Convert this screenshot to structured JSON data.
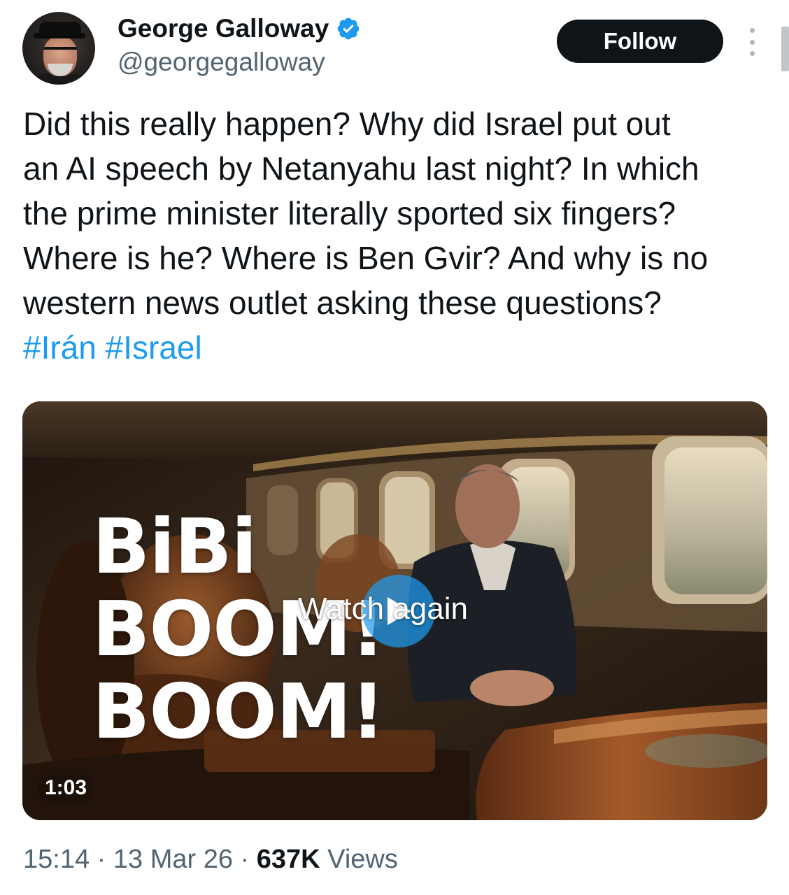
{
  "author": {
    "display_name": "George Galloway",
    "handle": "@georgegalloway",
    "verified_icon": "verified-badge-icon",
    "verified_color": "#1d9bf0"
  },
  "actions": {
    "follow_label": "Follow",
    "more_icon": "more-vertical-icon"
  },
  "tweet": {
    "text_lines": [
      "Did this really happen? Why did Israel put out",
      "an AI speech by Netanyahu last night? In which",
      "the prime minister literally sported six fingers?",
      "Where is he? Where is Ben Gvir? And why is no",
      "western news outlet asking these questions?"
    ],
    "hashtags": [
      "#Irán",
      "#Israel"
    ]
  },
  "media": {
    "overlay_title": [
      "BiBi",
      "BOOM!",
      "BOOM!"
    ],
    "watch_again_label": "Watch again",
    "play_icon": "play-icon",
    "duration": "1:03"
  },
  "meta": {
    "time": "15:14",
    "separator": " · ",
    "date": "13 Mar 26",
    "views_count": "637K",
    "views_label": "Views"
  },
  "colors": {
    "text": "#0f1419",
    "secondary": "#536471",
    "link": "#1d9bf0",
    "follow_bg": "#0f1419"
  }
}
